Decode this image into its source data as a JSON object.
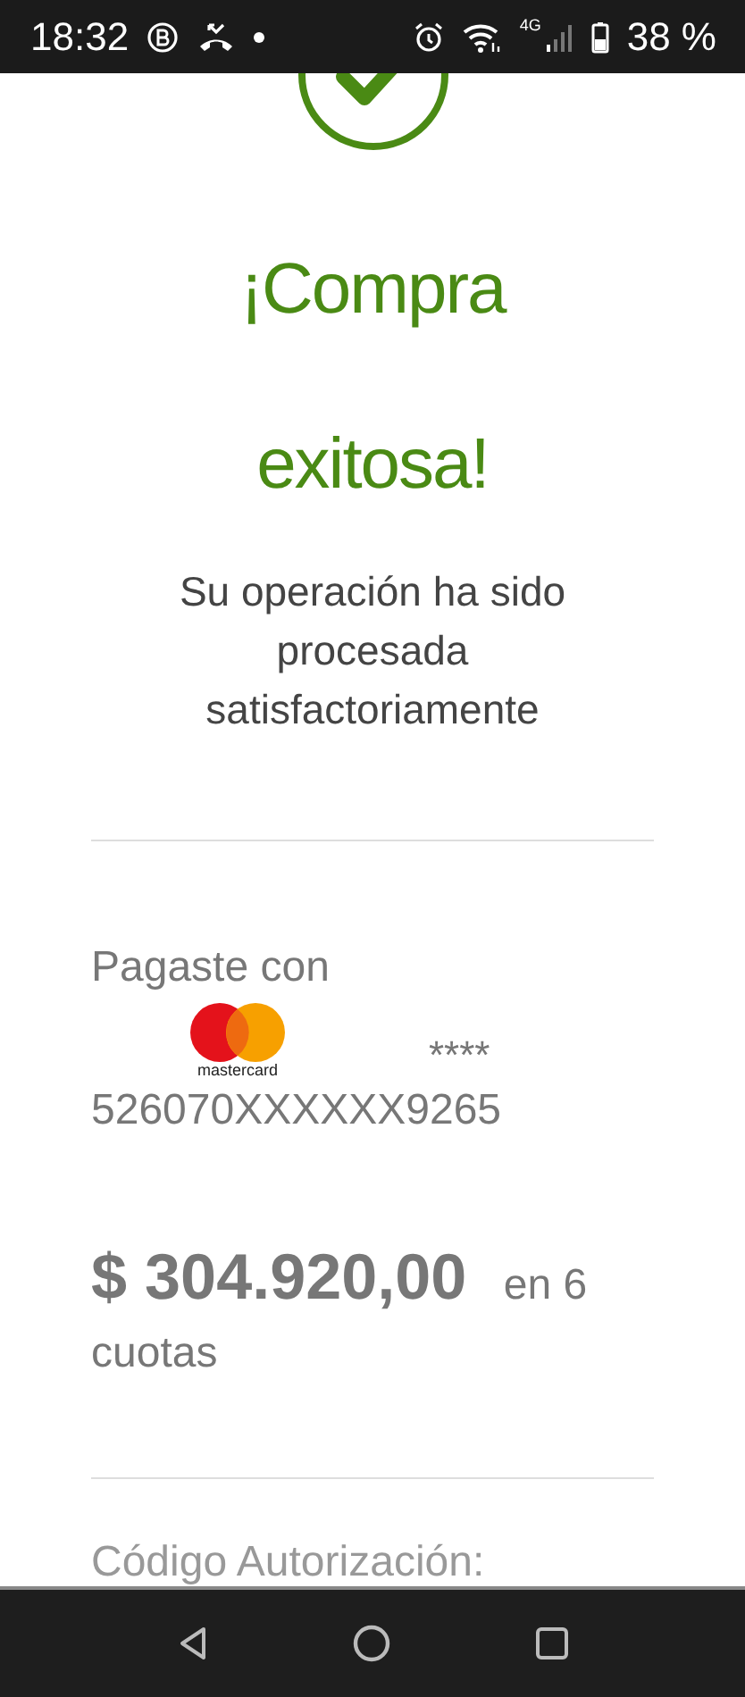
{
  "status_bar": {
    "time": "18:32",
    "battery": "38 %",
    "network": "4G"
  },
  "result": {
    "title": "¡Compra exitosa!",
    "message": "Su operación ha sido procesada satisfactoriamente"
  },
  "payment": {
    "label": "Pagaste con",
    "card_logo_text": "mastercard",
    "mask": "****",
    "card_number": "526070XXXXXX9265",
    "amount": "**$ 304.920,00** en 6 cuotas"
  },
  "authorization": {
    "label": "Código Autorización:"
  }
}
